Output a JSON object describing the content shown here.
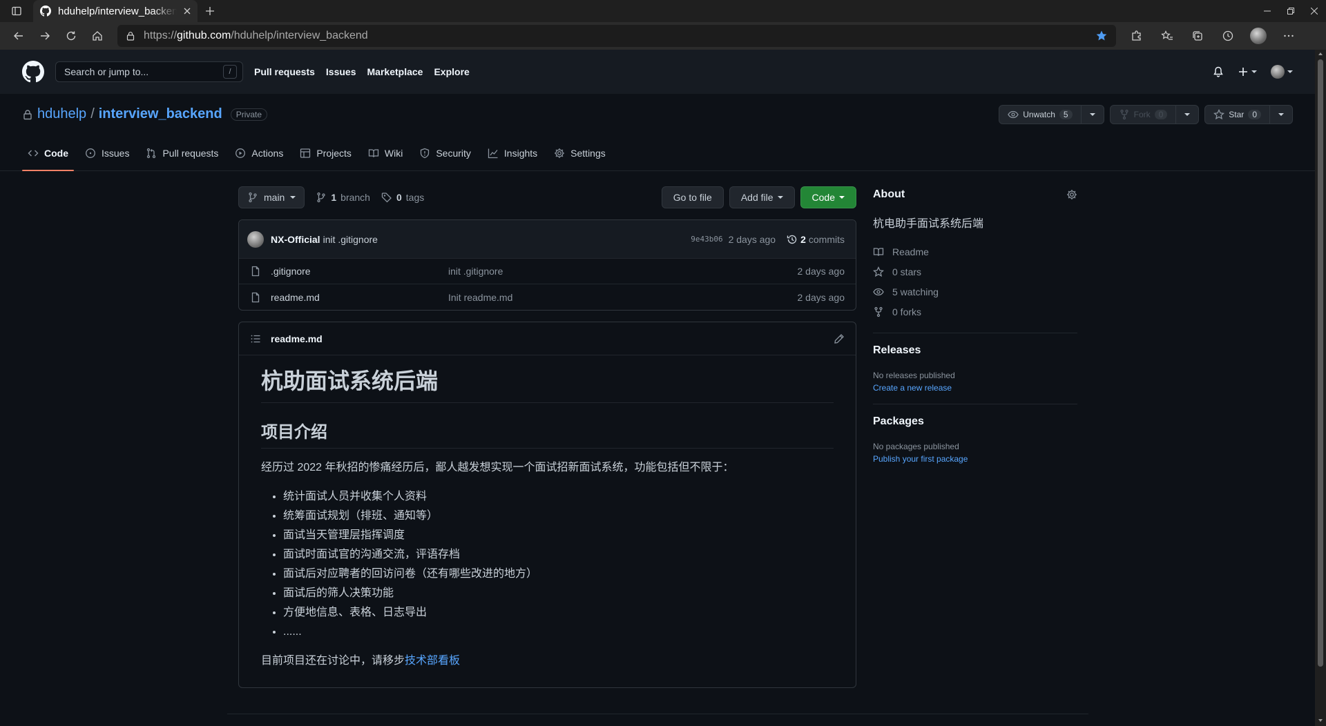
{
  "browser": {
    "tab_title": "hduhelp/interview_backend",
    "url_scheme": "https://",
    "url_host": "github.com",
    "url_path": "/hduhelp/interview_backend"
  },
  "gh_header": {
    "search_placeholder": "Search or jump to...",
    "search_key": "/",
    "nav": [
      "Pull requests",
      "Issues",
      "Marketplace",
      "Explore"
    ]
  },
  "repo": {
    "owner": "hduhelp",
    "separator": "/",
    "name": "interview_backend",
    "visibility": "Private",
    "watch_label": "Unwatch",
    "watch_count": "5",
    "fork_label": "Fork",
    "fork_count": "0",
    "star_label": "Star",
    "star_count": "0"
  },
  "tabs": [
    {
      "label": "Code",
      "icon": "code-icon"
    },
    {
      "label": "Issues",
      "icon": "issue-icon"
    },
    {
      "label": "Pull requests",
      "icon": "pull-request-icon"
    },
    {
      "label": "Actions",
      "icon": "play-icon"
    },
    {
      "label": "Projects",
      "icon": "table-icon"
    },
    {
      "label": "Wiki",
      "icon": "book-icon"
    },
    {
      "label": "Security",
      "icon": "shield-icon"
    },
    {
      "label": "Insights",
      "icon": "graph-icon"
    },
    {
      "label": "Settings",
      "icon": "gear-icon"
    }
  ],
  "file_nav": {
    "branch": "main",
    "branch_count": "1",
    "branch_label": "branch",
    "tag_count": "0",
    "tag_label": "tags",
    "go_to_file": "Go to file",
    "add_file": "Add file",
    "code": "Code"
  },
  "latest_commit": {
    "author": "NX-Official",
    "message": "init .gitignore",
    "sha": "9e43b06",
    "age": "2 days ago",
    "commit_count": "2",
    "commit_label": "commits"
  },
  "files": [
    {
      "name": ".gitignore",
      "message": "init .gitignore",
      "age": "2 days ago"
    },
    {
      "name": "readme.md",
      "message": "Init readme.md",
      "age": "2 days ago"
    }
  ],
  "readme": {
    "filename": "readme.md",
    "h1": "杭助面试系统后端",
    "h2": "项目介绍",
    "intro": "经历过 2022 年秋招的惨痛经历后，鄙人越发想实现一个面试招新面试系统，功能包括但不限于：",
    "list": [
      "统计面试人员并收集个人资料",
      "统筹面试规划（排班、通知等）",
      "面试当天管理层指挥调度",
      "面试时面试官的沟通交流，评语存档",
      "面试后对应聘者的回访问卷（还有哪些改进的地方）",
      "面试后的筛人决策功能",
      "方便地信息、表格、日志导出",
      "......"
    ],
    "footer_text": "目前项目还在讨论中，请移步",
    "footer_link": "技术部看板"
  },
  "sidebar": {
    "about_title": "About",
    "description": "杭电助手面试系统后端",
    "readme": "Readme",
    "stars": "0 stars",
    "watching": "5 watching",
    "forks": "0 forks",
    "releases_title": "Releases",
    "releases_none": "No releases published",
    "releases_link": "Create a new release",
    "packages_title": "Packages",
    "packages_none": "No packages published",
    "packages_link": "Publish your first package"
  },
  "colors": {
    "bg": "#0d1117",
    "header_bg": "#161b22",
    "link": "#58a6ff",
    "code_button": "#238636",
    "active_tab_underline": "#f78166"
  }
}
